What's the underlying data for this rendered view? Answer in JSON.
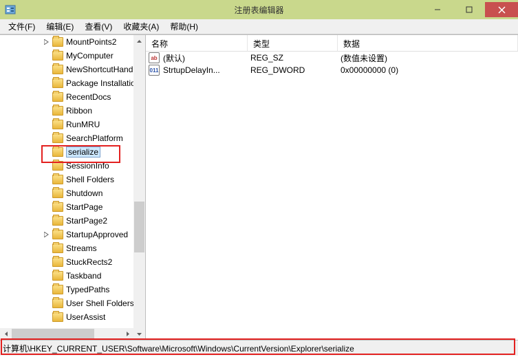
{
  "window": {
    "title": "注册表编辑器"
  },
  "menu": {
    "file": "文件(F)",
    "edit": "编辑(E)",
    "view": "查看(V)",
    "favorites": "收藏夹(A)",
    "help": "帮助(H)"
  },
  "tree": {
    "items": [
      {
        "indent": 62,
        "label": "MountPoints2",
        "expandable": true
      },
      {
        "indent": 62,
        "label": "MyComputer"
      },
      {
        "indent": 62,
        "label": "NewShortcutHandlers"
      },
      {
        "indent": 62,
        "label": "Package Installation"
      },
      {
        "indent": 62,
        "label": "RecentDocs"
      },
      {
        "indent": 62,
        "label": "Ribbon"
      },
      {
        "indent": 62,
        "label": "RunMRU"
      },
      {
        "indent": 62,
        "label": "SearchPlatform"
      },
      {
        "indent": 62,
        "label": "serialize",
        "selected": true
      },
      {
        "indent": 62,
        "label": "SessionInfo"
      },
      {
        "indent": 62,
        "label": "Shell Folders"
      },
      {
        "indent": 62,
        "label": "Shutdown"
      },
      {
        "indent": 62,
        "label": "StartPage"
      },
      {
        "indent": 62,
        "label": "StartPage2"
      },
      {
        "indent": 62,
        "label": "StartupApproved",
        "expandable": true
      },
      {
        "indent": 62,
        "label": "Streams"
      },
      {
        "indent": 62,
        "label": "StuckRects2"
      },
      {
        "indent": 62,
        "label": "Taskband"
      },
      {
        "indent": 62,
        "label": "TypedPaths"
      },
      {
        "indent": 62,
        "label": "User Shell Folders"
      },
      {
        "indent": 62,
        "label": "UserAssist"
      }
    ]
  },
  "columns": {
    "name": "名称",
    "type": "类型",
    "data": "数据"
  },
  "values": [
    {
      "icon": "sz",
      "iconText": "ab",
      "name": "(默认)",
      "type": "REG_SZ",
      "data": "(数值未设置)"
    },
    {
      "icon": "dw",
      "iconText": "011",
      "name": "StrtupDelayIn...",
      "type": "REG_DWORD",
      "data": "0x00000000 (0)"
    }
  ],
  "status": {
    "path": "计算机\\HKEY_CURRENT_USER\\Software\\Microsoft\\Windows\\CurrentVersion\\Explorer\\serialize"
  }
}
